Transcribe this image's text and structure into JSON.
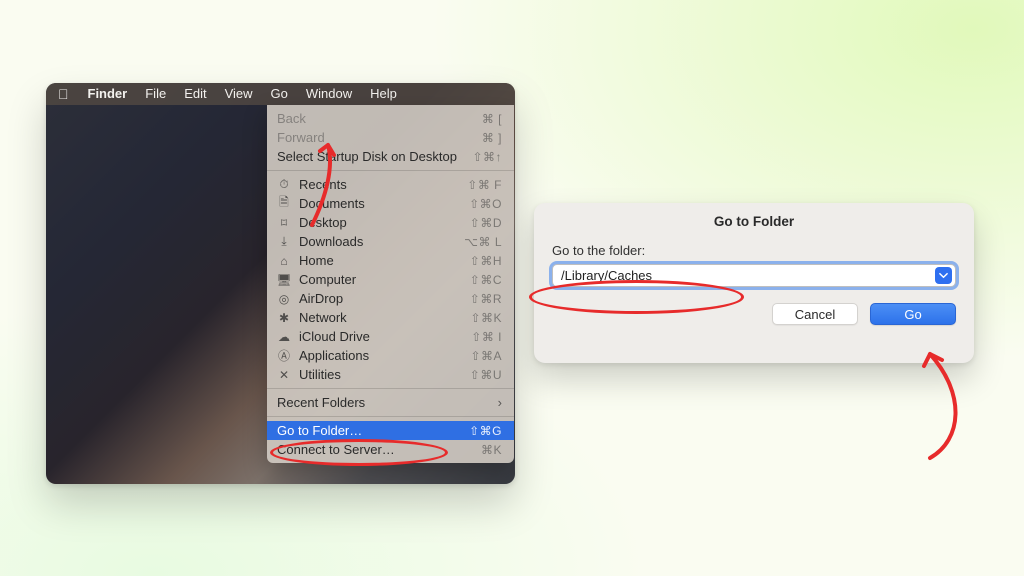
{
  "menubar": {
    "app": "Finder",
    "items": [
      "File",
      "Edit",
      "View",
      "Go",
      "Window",
      "Help"
    ]
  },
  "go_menu": {
    "back": {
      "label": "Back",
      "shortcut": "⌘ ["
    },
    "forward": {
      "label": "Forward",
      "shortcut": "⌘ ]"
    },
    "startup_disk": {
      "label": "Select Startup Disk on Desktop",
      "shortcut": "⇧⌘↑"
    },
    "recents": {
      "label": "Recents",
      "shortcut": "⇧⌘ F"
    },
    "documents": {
      "label": "Documents",
      "shortcut": "⇧⌘O"
    },
    "desktop": {
      "label": "Desktop",
      "shortcut": "⇧⌘D"
    },
    "downloads": {
      "label": "Downloads",
      "shortcut": "⌥⌘ L"
    },
    "home": {
      "label": "Home",
      "shortcut": "⇧⌘H"
    },
    "computer": {
      "label": "Computer",
      "shortcut": "⇧⌘C"
    },
    "airdrop": {
      "label": "AirDrop",
      "shortcut": "⇧⌘R"
    },
    "network": {
      "label": "Network",
      "shortcut": "⇧⌘K"
    },
    "icloud": {
      "label": "iCloud Drive",
      "shortcut": "⇧⌘ I"
    },
    "applications": {
      "label": "Applications",
      "shortcut": "⇧⌘A"
    },
    "utilities": {
      "label": "Utilities",
      "shortcut": "⇧⌘U"
    },
    "recent_folders": {
      "label": "Recent Folders"
    },
    "go_to_folder": {
      "label": "Go to Folder…",
      "shortcut": "⇧⌘G"
    },
    "connect_server": {
      "label": "Connect to Server…",
      "shortcut": "⌘K"
    }
  },
  "dialog": {
    "title": "Go to Folder",
    "label": "Go to the folder:",
    "value": "/Library/Caches",
    "cancel": "Cancel",
    "go": "Go"
  }
}
